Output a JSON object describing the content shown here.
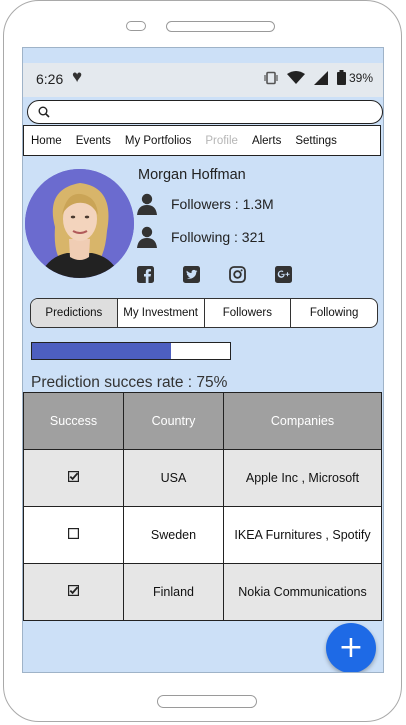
{
  "status_bar": {
    "time": "6:26",
    "battery": "39%"
  },
  "search": {
    "placeholder": ""
  },
  "nav": {
    "items": [
      {
        "label": "Home",
        "state": "normal"
      },
      {
        "label": "Events",
        "state": "normal"
      },
      {
        "label": "My Portfolios",
        "state": "normal"
      },
      {
        "label": "Profile",
        "state": "disabled"
      },
      {
        "label": "Alerts",
        "state": "normal"
      },
      {
        "label": "Settings",
        "state": "normal"
      }
    ]
  },
  "profile": {
    "name": "Morgan Hoffman",
    "followers": "Followers : 1.3M",
    "following": "Following : 321",
    "social_icons": [
      "facebook-icon",
      "twitter-icon",
      "instagram-icon",
      "google-plus-icon"
    ]
  },
  "tabs": [
    {
      "label": "Predictions",
      "active": true
    },
    {
      "label": "My Investment",
      "active": false
    },
    {
      "label": "Followers",
      "active": false
    },
    {
      "label": "Following",
      "active": false
    }
  ],
  "progress": {
    "percent": 70
  },
  "prediction_rate": "Prediction succes rate : 75%",
  "table": {
    "headers": [
      "Success",
      "Country",
      "Companies"
    ],
    "rows": [
      {
        "success": true,
        "country": "USA",
        "companies": "Apple Inc , Microsoft"
      },
      {
        "success": false,
        "country": "Sweden",
        "companies": "IKEA Furnitures , Spotify"
      },
      {
        "success": true,
        "country": "Finland",
        "companies": "Nokia Communications"
      }
    ]
  },
  "fab": {
    "label": "+"
  },
  "colors": {
    "screen_bg": "#cce0f7",
    "accent": "#1e6ae6",
    "progress": "#4d5fc0",
    "avatar_bg": "#6b6bcf",
    "header_bg": "#a0a0a0"
  }
}
